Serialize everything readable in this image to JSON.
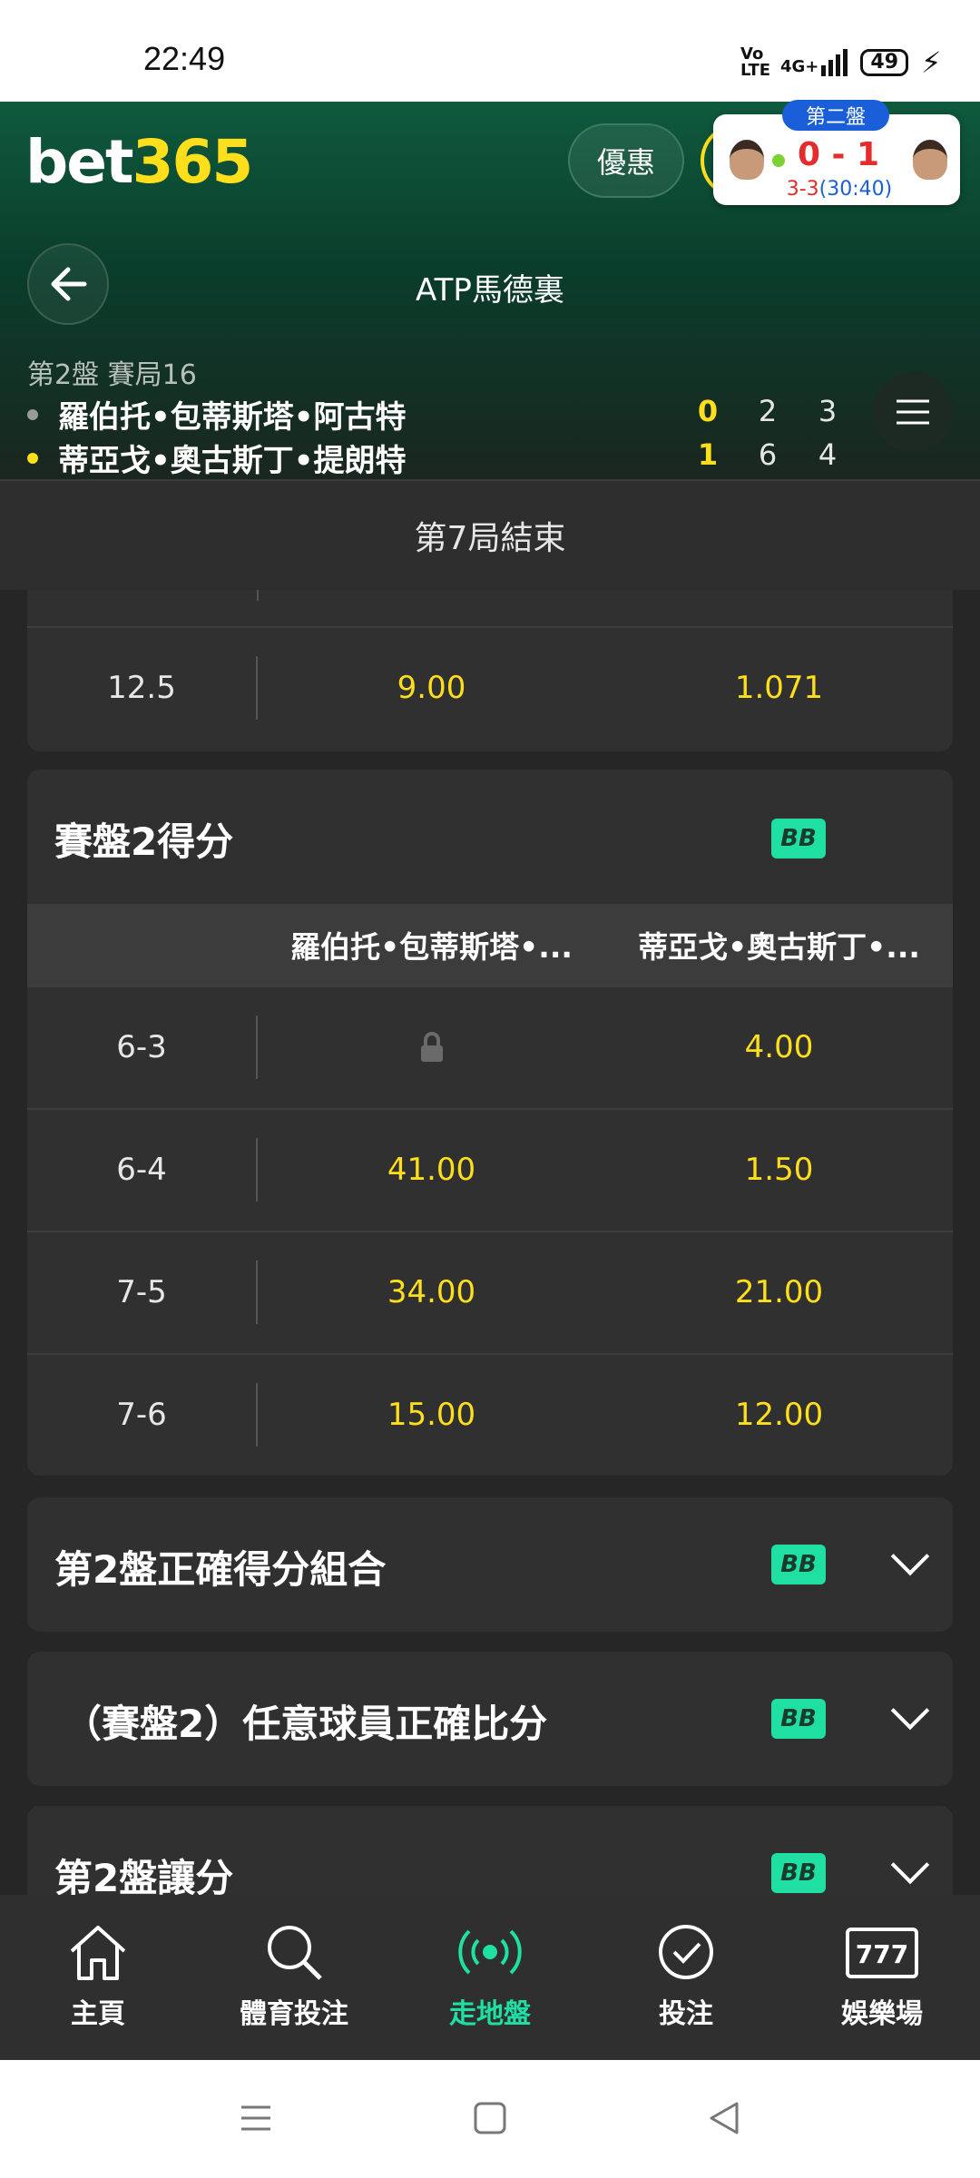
{
  "status_bar": {
    "time": "22:49",
    "network": "Vo LTE",
    "signal": "4G+",
    "battery": "49"
  },
  "header": {
    "logo_part1": "bet",
    "logo_part2": "365",
    "promo_label": "優惠",
    "scorecard": {
      "set_label": "第二盤",
      "score": "0 - 1",
      "game_score": "3-3",
      "clock": "(30:40)"
    },
    "league": "ATP馬德裏",
    "set_info": "第2盤 賽局16",
    "players": [
      {
        "name": "羅伯托•包蒂斯塔•阿古特",
        "dot_color": "#9a9a9a",
        "scores": [
          "0",
          "2",
          "3"
        ]
      },
      {
        "name": "蒂亞戈•奧古斯丁•提朗特",
        "dot_color": "#ffdf1b",
        "scores": [
          "1",
          "6",
          "4"
        ]
      }
    ]
  },
  "game_ended": "第7局結束",
  "prev_card": {
    "rows": [
      {
        "label": "12.5",
        "odd1": "9.00",
        "odd2": "1.071"
      }
    ]
  },
  "set2_score": {
    "title": "賽盤2得分",
    "badge": "BB",
    "col1": "羅伯托•包蒂斯塔•...",
    "col2": "蒂亞戈•奧古斯丁•...",
    "rows": [
      {
        "label": "6-3",
        "odd1": "",
        "odd2": "4.00",
        "locked": true
      },
      {
        "label": "6-4",
        "odd1": "41.00",
        "odd2": "1.50"
      },
      {
        "label": "7-5",
        "odd1": "34.00",
        "odd2": "21.00"
      },
      {
        "label": "7-6",
        "odd1": "15.00",
        "odd2": "12.00"
      }
    ]
  },
  "markets": [
    {
      "title": "第2盤正確得分組合",
      "badge": "BB"
    },
    {
      "title": "（賽盤2）任意球員正確比分",
      "badge": "BB"
    },
    {
      "title": "第2盤讓分",
      "badge": "BB"
    }
  ],
  "bottom_nav": [
    {
      "label": "主頁",
      "icon": "home-icon"
    },
    {
      "label": "體育投注",
      "icon": "search-icon"
    },
    {
      "label": "走地盤",
      "icon": "live-broadcast-icon",
      "active": true
    },
    {
      "label": "投注",
      "icon": "checkmark-circle-icon"
    },
    {
      "label": "娛樂場",
      "icon": "slot-machine-icon"
    }
  ],
  "colors": {
    "accent_yellow": "#ffdf1b",
    "accent_green": "#1fe0a2",
    "header_green": "#0f5a3d",
    "score_red": "#e52b2b"
  }
}
